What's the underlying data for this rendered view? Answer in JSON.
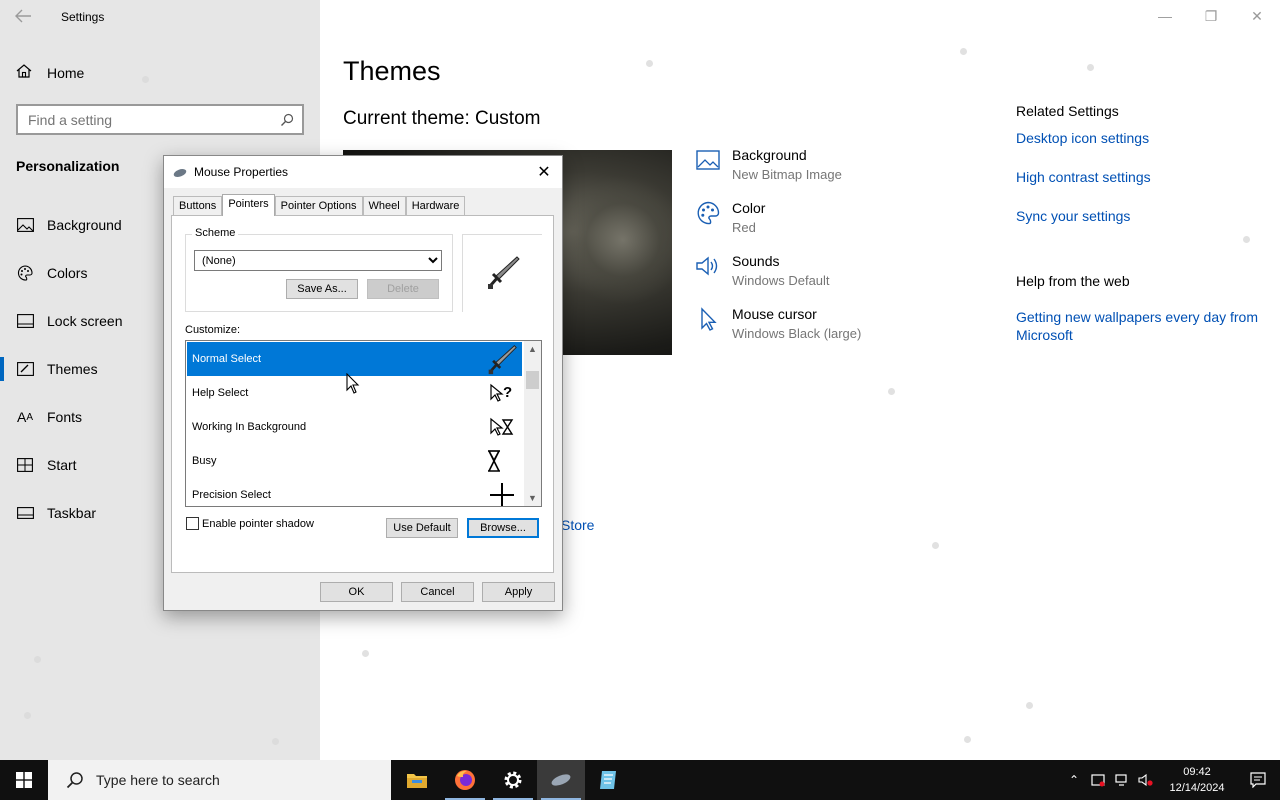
{
  "app": {
    "title": "Settings"
  },
  "sidebar": {
    "home_label": "Home",
    "search_placeholder": "Find a setting",
    "section_title": "Personalization",
    "items": [
      {
        "label": "Background",
        "icon": "picture-icon"
      },
      {
        "label": "Colors",
        "icon": "palette-icon"
      },
      {
        "label": "Lock screen",
        "icon": "lock-screen-icon"
      },
      {
        "label": "Themes",
        "icon": "brush-icon",
        "active": true
      },
      {
        "label": "Fonts",
        "icon": "font-icon"
      },
      {
        "label": "Start",
        "icon": "start-grid-icon"
      },
      {
        "label": "Taskbar",
        "icon": "taskbar-icon"
      }
    ]
  },
  "main": {
    "page_title": "Themes",
    "current_theme": "Current theme: Custom",
    "properties": [
      {
        "title": "Background",
        "subtitle": "New Bitmap Image",
        "icon": "picture-icon"
      },
      {
        "title": "Color",
        "subtitle": "Red",
        "icon": "palette-icon"
      },
      {
        "title": "Sounds",
        "subtitle": "Windows Default",
        "icon": "speaker-icon"
      },
      {
        "title": "Mouse cursor",
        "subtitle": "Windows Black (large)",
        "icon": "cursor-icon"
      }
    ],
    "store_link": "Store"
  },
  "related": {
    "heading": "Related Settings",
    "links": [
      "Desktop icon settings",
      "High contrast settings",
      "Sync your settings"
    ],
    "help_heading": "Help from the web",
    "help_link": "Getting new wallpapers every day from Microsoft"
  },
  "dialog": {
    "title": "Mouse Properties",
    "tabs": [
      "Buttons",
      "Pointers",
      "Pointer Options",
      "Wheel",
      "Hardware"
    ],
    "selected_tab": "Pointers",
    "scheme_label": "Scheme",
    "scheme_value": "(None)",
    "save_as": "Save As...",
    "delete": "Delete",
    "customize_label": "Customize:",
    "cursors": [
      {
        "name": "Normal Select",
        "icon": "sword-cursor-icon",
        "selected": true
      },
      {
        "name": "Help Select",
        "icon": "help-cursor-icon"
      },
      {
        "name": "Working In Background",
        "icon": "working-cursor-icon"
      },
      {
        "name": "Busy",
        "icon": "hourglass-icon"
      },
      {
        "name": "Precision Select",
        "icon": "crosshair-icon"
      }
    ],
    "enable_shadow": "Enable pointer shadow",
    "use_default": "Use Default",
    "browse": "Browse...",
    "ok": "OK",
    "cancel": "Cancel",
    "apply": "Apply"
  },
  "taskbar": {
    "search_placeholder": "Type here to search",
    "apps": [
      "file-explorer-icon",
      "firefox-icon",
      "settings-gear-icon",
      "mouse-properties-icon",
      "notepad-icon"
    ],
    "time": "09:42",
    "date": "12/14/2024"
  },
  "colors": {
    "accent": "#0078d7",
    "link": "#0050b4",
    "sidebar_bg": "#e6e6e6",
    "taskbar_bg": "#101010"
  }
}
